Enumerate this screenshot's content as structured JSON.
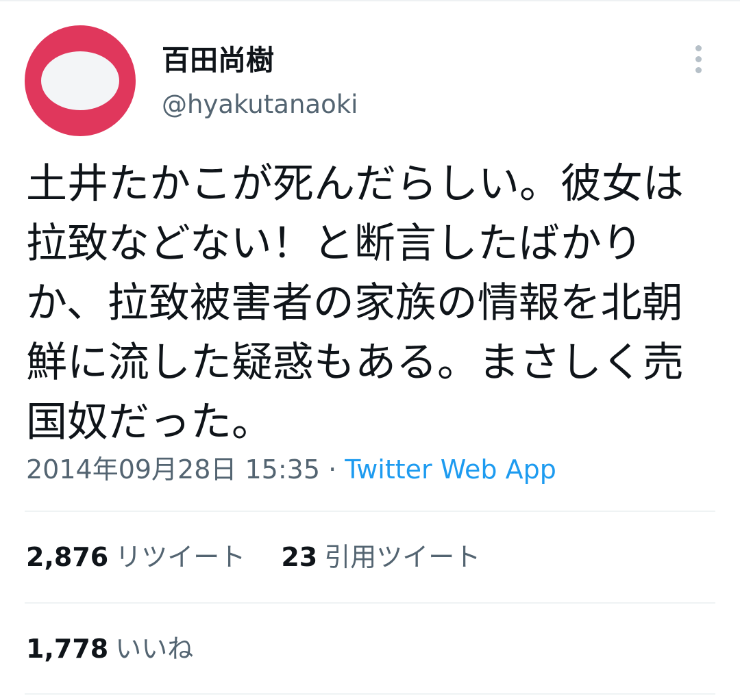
{
  "tweet": {
    "display_name": "百田尚樹",
    "handle": "@hyakutanaoki",
    "text": "土井たかこが死んだらしい。彼女は拉致などない！と断言したばかりか、拉致被害者の家族の情報を北朝鮮に流した疑惑もある。まさしく売国奴だった。",
    "timestamp": "2014年09月28日 15:35",
    "separator": " · ",
    "source": "Twitter Web App"
  },
  "stats": {
    "retweets": {
      "count": "2,876",
      "label": "リツイート"
    },
    "quote_tweets": {
      "count": "23",
      "label": "引用ツイート"
    },
    "likes": {
      "count": "1,778",
      "label": "いいね"
    }
  },
  "icons": {
    "more": "more-vertical-icon"
  },
  "colors": {
    "avatar_red": "#e0375c",
    "link_blue": "#1d9bf0",
    "secondary_text": "#536471",
    "primary_text": "#0f1419",
    "divider": "#eff3f4"
  }
}
